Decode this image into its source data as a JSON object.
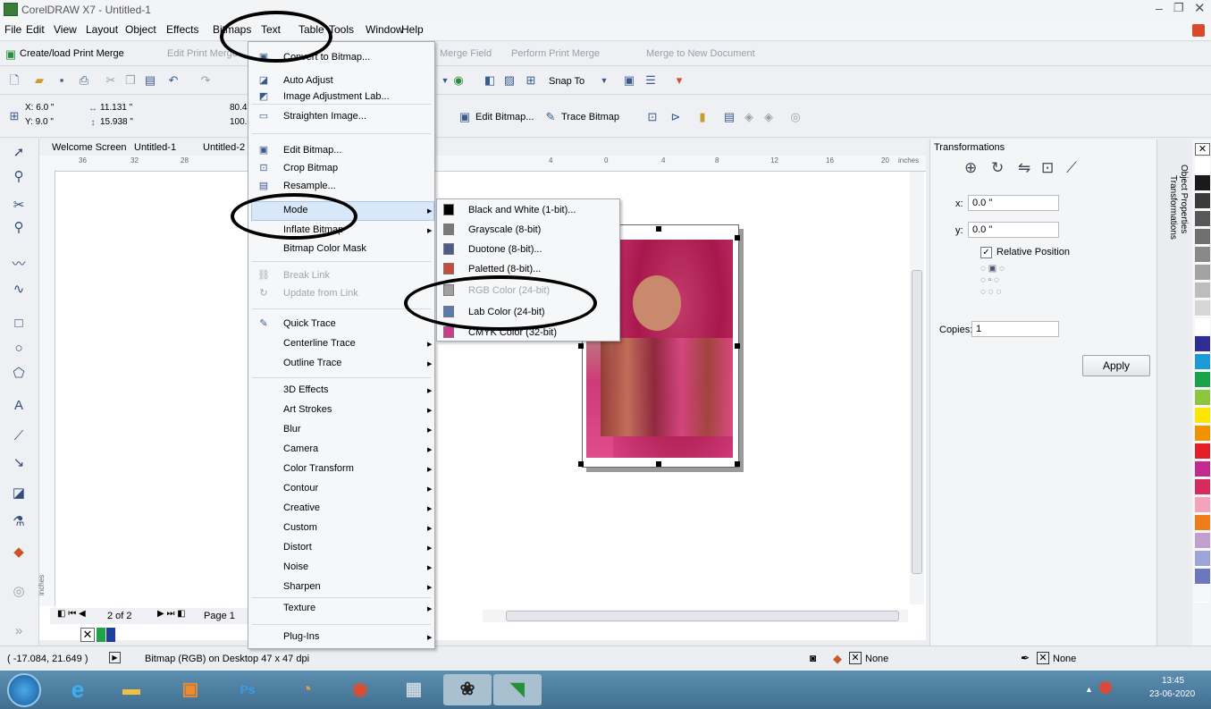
{
  "app": {
    "title": "CorelDRAW X7 - Untitled-1"
  },
  "menubar": {
    "items": [
      "File",
      "Edit",
      "View",
      "Layout",
      "Object",
      "Effects",
      "Bitmaps",
      "Text",
      "Table",
      "Tools",
      "Window",
      "Help"
    ]
  },
  "merge_bar": {
    "create": "Create/load Print Merge",
    "edit": "Edit Print Merge",
    "merge_field": "Merge Field",
    "perform": "Perform Print Merge",
    "new_doc": "Merge to New Document"
  },
  "std_bar": {
    "snap_to": "Snap To"
  },
  "prop_bar": {
    "x": "X: 6.0 \"",
    "y": "Y: 9.0 \"",
    "w": "11.131 \"",
    "h": "15.938 \"",
    "sx": "80.4",
    "sy": "100.0",
    "edit_bitmap": "Edit Bitmap...",
    "trace_bitmap": "Trace Bitmap"
  },
  "doc_tabs": {
    "items": [
      "Welcome Screen",
      "Untitled-1",
      "Untitled-2"
    ]
  },
  "ruler": {
    "top_ticks": [
      "36",
      "32",
      "28",
      "4",
      "0",
      "4",
      "8",
      "12",
      "16",
      "20"
    ],
    "units": "inches",
    "left_units": "inches"
  },
  "pager": {
    "count": "2 of 2",
    "page": "Page 1"
  },
  "bitmaps_menu": {
    "items": [
      {
        "label": "Convert to Bitmap...",
        "icon": "convert-bitmap-icon",
        "submenu": false,
        "enabled": true
      },
      {
        "label": "Auto Adjust",
        "icon": "auto-adjust-icon",
        "submenu": false,
        "enabled": true
      },
      {
        "label": "Image Adjustment Lab...",
        "icon": "image-adjust-lab-icon",
        "submenu": false,
        "enabled": true
      },
      {
        "label": "Straighten Image...",
        "icon": "straighten-icon",
        "submenu": false,
        "enabled": true
      },
      {
        "label": "Edit Bitmap...",
        "icon": "edit-bitmap-icon",
        "submenu": false,
        "enabled": true
      },
      {
        "label": "Crop Bitmap",
        "icon": "crop-bitmap-icon",
        "submenu": false,
        "enabled": true
      },
      {
        "label": "Resample...",
        "icon": "resample-icon",
        "submenu": false,
        "enabled": true
      },
      {
        "label": "Mode",
        "icon": "",
        "submenu": true,
        "enabled": true
      },
      {
        "label": "Inflate Bitmap",
        "icon": "",
        "submenu": true,
        "enabled": true
      },
      {
        "label": "Bitmap Color Mask",
        "icon": "",
        "submenu": false,
        "enabled": true
      },
      {
        "label": "Break Link",
        "icon": "break-link-icon",
        "submenu": false,
        "enabled": false
      },
      {
        "label": "Update from Link",
        "icon": "update-link-icon",
        "submenu": false,
        "enabled": false
      },
      {
        "label": "Quick Trace",
        "icon": "quick-trace-icon",
        "submenu": false,
        "enabled": true
      },
      {
        "label": "Centerline Trace",
        "icon": "",
        "submenu": true,
        "enabled": true
      },
      {
        "label": "Outline Trace",
        "icon": "",
        "submenu": true,
        "enabled": true
      },
      {
        "label": "3D Effects",
        "icon": "",
        "submenu": true,
        "enabled": true
      },
      {
        "label": "Art Strokes",
        "icon": "",
        "submenu": true,
        "enabled": true
      },
      {
        "label": "Blur",
        "icon": "",
        "submenu": true,
        "enabled": true
      },
      {
        "label": "Camera",
        "icon": "",
        "submenu": true,
        "enabled": true
      },
      {
        "label": "Color Transform",
        "icon": "",
        "submenu": true,
        "enabled": true
      },
      {
        "label": "Contour",
        "icon": "",
        "submenu": true,
        "enabled": true
      },
      {
        "label": "Creative",
        "icon": "",
        "submenu": true,
        "enabled": true
      },
      {
        "label": "Custom",
        "icon": "",
        "submenu": true,
        "enabled": true
      },
      {
        "label": "Distort",
        "icon": "",
        "submenu": true,
        "enabled": true
      },
      {
        "label": "Noise",
        "icon": "",
        "submenu": true,
        "enabled": true
      },
      {
        "label": "Sharpen",
        "icon": "",
        "submenu": true,
        "enabled": true
      },
      {
        "label": "Texture",
        "icon": "",
        "submenu": true,
        "enabled": true
      },
      {
        "label": "Plug-Ins",
        "icon": "",
        "submenu": true,
        "enabled": true
      }
    ]
  },
  "mode_menu": {
    "items": [
      {
        "label": "Black and White (1-bit)...",
        "enabled": true,
        "icon_color": "#000000"
      },
      {
        "label": "Grayscale (8-bit)",
        "enabled": true,
        "icon_color": "#7a7a7a"
      },
      {
        "label": "Duotone (8-bit)...",
        "enabled": true,
        "icon_color": "#4a5a8a"
      },
      {
        "label": "Paletted (8-bit)...",
        "enabled": true,
        "icon_color": "#c84a3a"
      },
      {
        "label": "RGB Color (24-bit)",
        "enabled": false,
        "icon_color": "#a0a0a0"
      },
      {
        "label": "Lab Color (24-bit)",
        "enabled": true,
        "icon_color": "#5a7ab0"
      },
      {
        "label": "CMYK Color (32-bit)",
        "enabled": true,
        "icon_color": "#d03c8c"
      }
    ]
  },
  "docker": {
    "title": "Transformations",
    "x_label": "x:",
    "x_value": "0.0 \"",
    "y_label": "y:",
    "y_value": "0.0 \"",
    "relative": "Relative Position",
    "copies_label": "Copies:",
    "copies_value": "1",
    "apply": "Apply",
    "tab_transformations": "Transformations",
    "tab_object_properties": "Object Properties"
  },
  "palette": {
    "colors": [
      "#ffffff",
      "#1a1a1a",
      "#3a3a3a",
      "#575757",
      "#6f6f6f",
      "#898989",
      "#a2a2a2",
      "#bdbdbd",
      "#d7d7d7",
      "#ffffff",
      "#2f2d93",
      "#1b9ad6",
      "#18a34a",
      "#8dc53e",
      "#ffe600",
      "#f29200",
      "#e41e26",
      "#c22a8e",
      "#d62b5c",
      "#f4a3bd",
      "#ef7d1a",
      "#bfa0cf",
      "#9ea3d8",
      "#6c78bd",
      "#f6f7f9"
    ]
  },
  "status": {
    "coords": "( -17.084, 21.649 )",
    "info": "Bitmap (RGB) on Desktop 47 x 47 dpi",
    "fill": "None",
    "outline": "None"
  },
  "taskbar": {
    "time": "13:45",
    "date": "23-06-2020",
    "apps": [
      "windows-start",
      "ie-icon",
      "explorer-icon",
      "media-icon",
      "photoshop-icon",
      "paint-icon",
      "chrome-icon",
      "calc-icon",
      "app-icon",
      "coreldraw-icon"
    ],
    "ps_label": "Ps"
  }
}
